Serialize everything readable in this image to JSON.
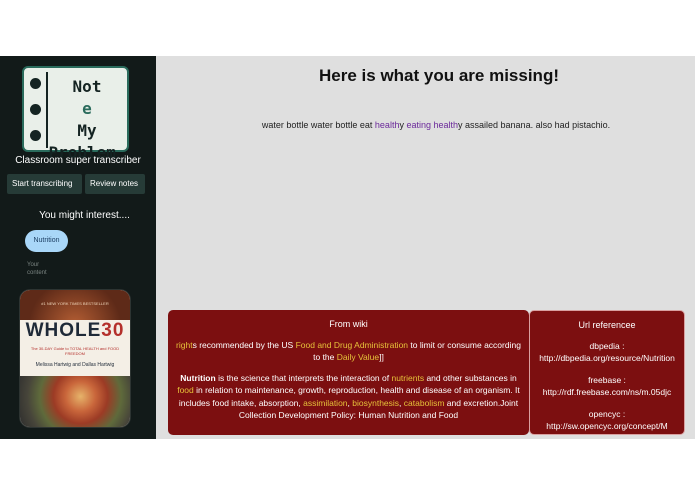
{
  "sidebar": {
    "logo": {
      "line1_a": "Not",
      "line1_b": "e",
      "line2": "My",
      "line3": "Problem_"
    },
    "tagline": "Classroom super transcriber",
    "buttons": {
      "start": "Start transcribing",
      "review": "Review notes"
    },
    "interest_heading": "You might interest....",
    "chip": "Nutrition",
    "book_alt_text": "Your content",
    "book": {
      "bestseller": "#1 NEW YORK TIMES BESTSELLER",
      "title_a": "WHOLE",
      "title_b": "30",
      "subtitle": "The 30-DAY Guide to TOTAL HEALTH and FOOD FREEDOM",
      "authors": "Melissa Hartwig and Dallas Hartwig"
    }
  },
  "main": {
    "heading": "Here is what you are missing!",
    "transcript": {
      "t1": "water bottle water bottle eat ",
      "h1": "health",
      "t2": "y ",
      "h2": "eating health",
      "t3": "y assailed banana. also had pistachio."
    }
  },
  "wiki": {
    "heading": "From wiki",
    "p1": {
      "link1": "right",
      "t1": "s recommended by the US ",
      "link2": "Food and Drug Administration",
      "t2": " to limit or consume according to the ",
      "link3": "Daily Value",
      "t3": "]]"
    },
    "p2": {
      "bold": "Nutrition",
      "t1": " is the science that interprets the interaction of ",
      "link1": "nutrients",
      "t2": " and other substances in ",
      "link2": "food",
      "t3": " in relation to maintenance, growth, reproduction, health and disease of an organism. It includes food intake, absorption, ",
      "link3": "assimilation",
      "t4": ", ",
      "link4": "biosynthesis",
      "t5": ", ",
      "link5": "catabolism",
      "t6": " and excretion.Joint Collection Development Policy: Human Nutrition and Food"
    }
  },
  "urls": {
    "heading": "Url referencee",
    "items": [
      {
        "label": "dbpedia :",
        "url": "http://dbpedia.org/resource/Nutrition"
      },
      {
        "label": "freebase :",
        "url": "http://rdf.freebase.com/ns/m.05djc"
      },
      {
        "label": "opencyc :",
        "url": "http://sw.opencyc.org/concept/M"
      }
    ]
  },
  "colors": {
    "sidebar_bg": "#121a19",
    "main_bg": "#dfdfdf",
    "panel_bg": "#7c0f10",
    "link_yellow": "#e6c23a",
    "highlight_purple": "#6b2a9a",
    "chip_bg": "#a9d7f8"
  }
}
